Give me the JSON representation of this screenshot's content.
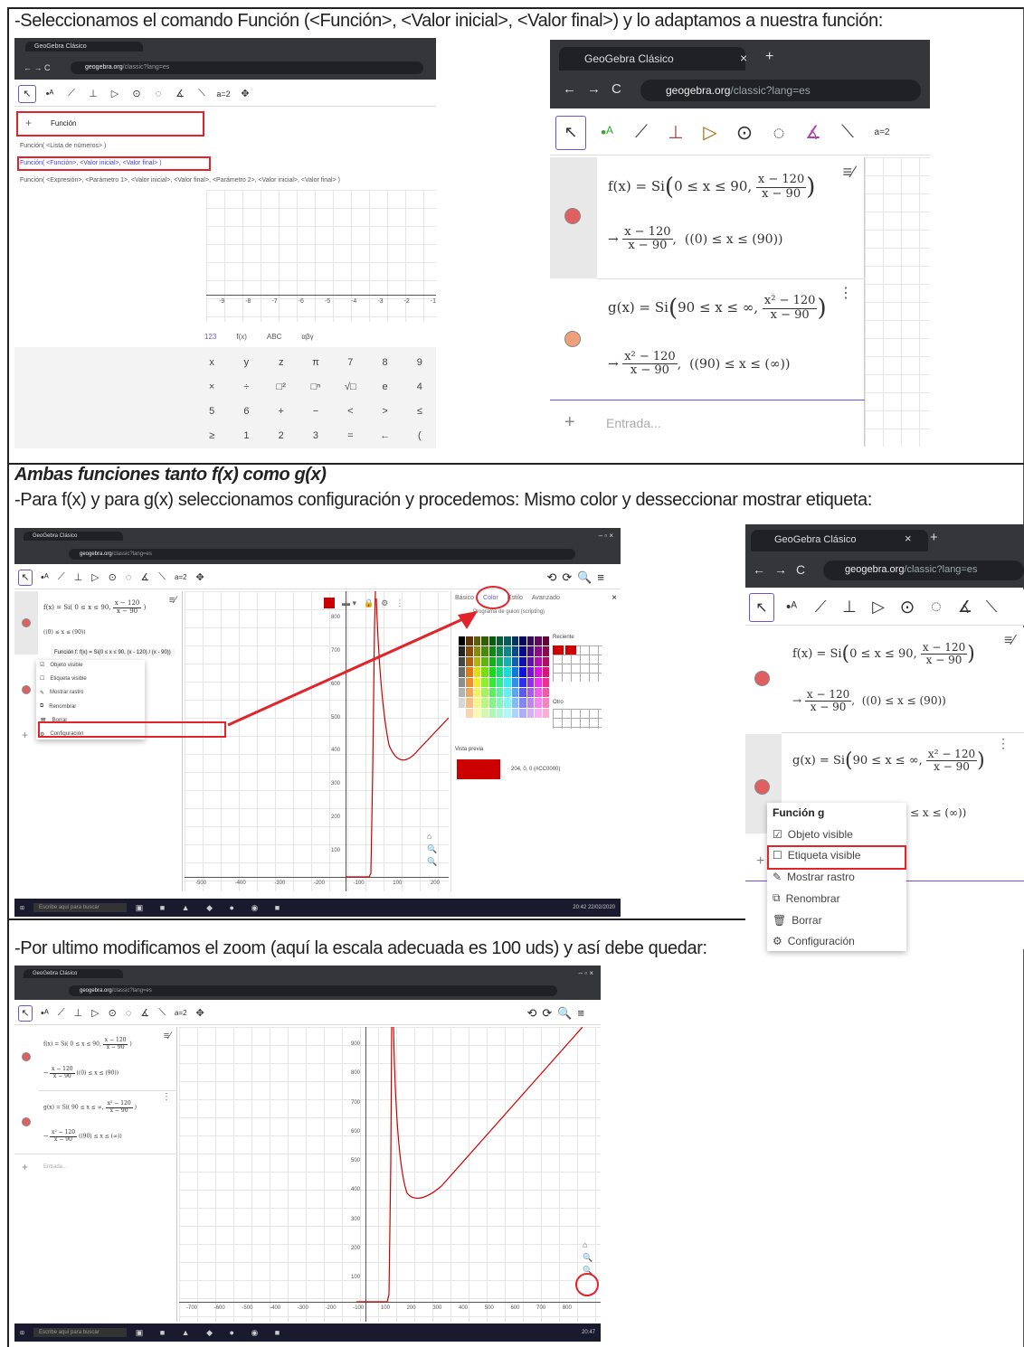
{
  "steps": {
    "step1": "-Seleccionamos el comando Función (<Función>, <Valor inicial>, <Valor final>) y lo adaptamos a nuestra función:",
    "heading2": "Ambas funciones tanto f(x) como g(x)",
    "step2": "-Para  f(x) y para g(x) seleccionamos configuración y procedemos: Mismo color  y desseccionar mostrar etiqueta:",
    "step3": "-Por ultimo modificamos el zoom (aquí la escala adecuada es 100 uds) y así debe quedar:"
  },
  "browser": {
    "tab_title": "GeoGebra Clásico",
    "url_domain": "geogebra.org",
    "url_path": "/classic?lang=es"
  },
  "panel1": {
    "input_value": "Función",
    "suggestions": [
      "Función( <Lista de números> )",
      "Función( <Función>, <Valor inicial>, <Valor final> )",
      "Función( <Expresión>, <Parámetro 1>, <Valor inicial>, <Valor final>, <Parámetro 2>, <Valor inicial>, <Valor final> )"
    ],
    "x_ticks": [
      "-9",
      "-8",
      "-7",
      "-6",
      "-5",
      "-4",
      "-3",
      "-2",
      "-1"
    ],
    "keypad_tabs": [
      "123",
      "f(x)",
      "ABC",
      "αβγ"
    ],
    "keys": [
      "x",
      "y",
      "z",
      "π",
      "7",
      "8",
      "9",
      "×",
      "÷",
      "□²",
      "□ⁿ",
      "√□",
      "e",
      "4",
      "5",
      "6",
      "+",
      "−",
      "<",
      ">",
      "≤",
      "≥",
      "1",
      "2",
      "3",
      "=",
      "←",
      "(",
      ")",
      "|□|",
      ",",
      "0",
      ".",
      "<",
      ">",
      "↵"
    ]
  },
  "panel2": {
    "f_def": "f(x) = Si",
    "f_cond": "0 ≤ x ≤ 90,",
    "f_num": "x − 120",
    "f_den": "x − 90",
    "f_range": "((0) ≤ x ≤ (90))",
    "g_def": "g(x) = Si",
    "g_cond": "90 ≤ x ≤ ∞,",
    "g_num": "x² − 120",
    "g_den": "x − 90",
    "g_range": "((90) ≤ x ≤ (∞))",
    "input_placeholder": "Entrada...",
    "tools_label": "a=2"
  },
  "panel3": {
    "caption": "Función f: f(x) = Si(0 ≤ x ≤ 90, (x - 120) / (x - 90))",
    "menu": [
      "Objeto visible",
      "Etiqueta visible",
      "Mostrar rastro",
      "Renombrar",
      "Borrar",
      "Configuración"
    ],
    "tabs": [
      "Básico",
      "Color",
      "Estilo",
      "Avanzado"
    ],
    "scripting": "Programa de guion (scripting)",
    "recent": "Reciente",
    "other": "Otro",
    "preview": "Vista previa",
    "color_value": "204, 0, 0 (#CC0000)",
    "y_ticks": [
      "800",
      "700",
      "600",
      "500",
      "400",
      "300",
      "200",
      "100"
    ],
    "x_ticks": [
      "-500",
      "-400",
      "-300",
      "-200",
      "-100",
      "100",
      "200"
    ],
    "taskbar_search": "Escribe aquí para buscar",
    "clock_time": "20:42",
    "clock_date": "22/02/2020"
  },
  "panel4": {
    "menu_title": "Función g",
    "menu": [
      "Objeto visible",
      "Etiqueta visible",
      "Mostrar rastro",
      "Renombrar",
      "Borrar",
      "Configuración"
    ],
    "g_range_tail": "≤ x ≤ (∞))"
  },
  "panel5": {
    "y_ticks": [
      "900",
      "800",
      "700",
      "600",
      "500",
      "400",
      "300",
      "200",
      "100"
    ],
    "x_ticks": [
      "-700",
      "-600",
      "-500",
      "-400",
      "-300",
      "-200",
      "-100",
      "100",
      "200",
      "300",
      "400",
      "500",
      "600",
      "700",
      "800"
    ],
    "input_placeholder": "Entrada...",
    "taskbar_search": "Escribe aquí para buscar",
    "clock_time": "20:47"
  },
  "colors": {
    "accent_red": "#e0242a",
    "curve_red": "#cc0000",
    "f_dot": "#e06060",
    "g_dot": "#f0a078",
    "geogebra_purple": "#6557d2"
  }
}
